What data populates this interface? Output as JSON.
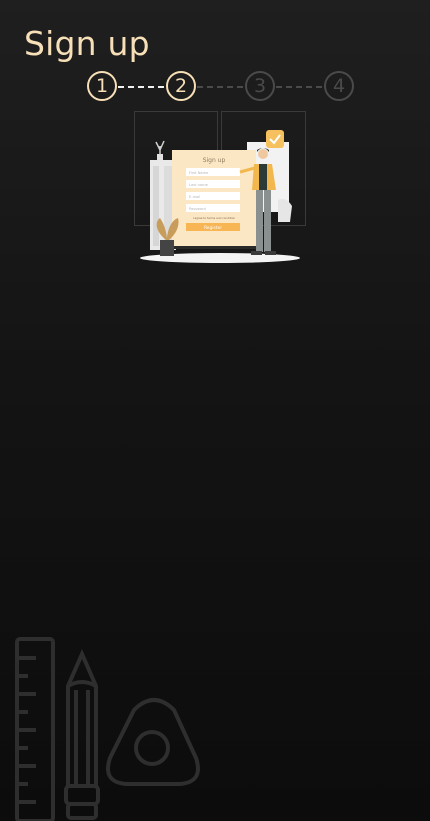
{
  "header": {
    "title": "Sign up"
  },
  "stepper": {
    "steps": [
      {
        "label": "1",
        "state": "completed"
      },
      {
        "label": "2",
        "state": "active"
      },
      {
        "label": "3",
        "state": "inactive"
      },
      {
        "label": "4",
        "state": "inactive"
      }
    ]
  },
  "illustration": {
    "form_title": "Sign up",
    "fields": [
      "First Name",
      "Last name",
      "E-mail",
      "Password"
    ],
    "terms": "I agree to terms and condition",
    "button": "Register"
  },
  "colors": {
    "accent": "#f7dfb7",
    "inactive": "#4a4a4a",
    "background_top": "#1f1f1f",
    "background_bottom": "#0c0c0c"
  },
  "icons": {
    "decoration": [
      "ruler-icon",
      "pencil-icon",
      "triangle-eraser-icon"
    ]
  }
}
